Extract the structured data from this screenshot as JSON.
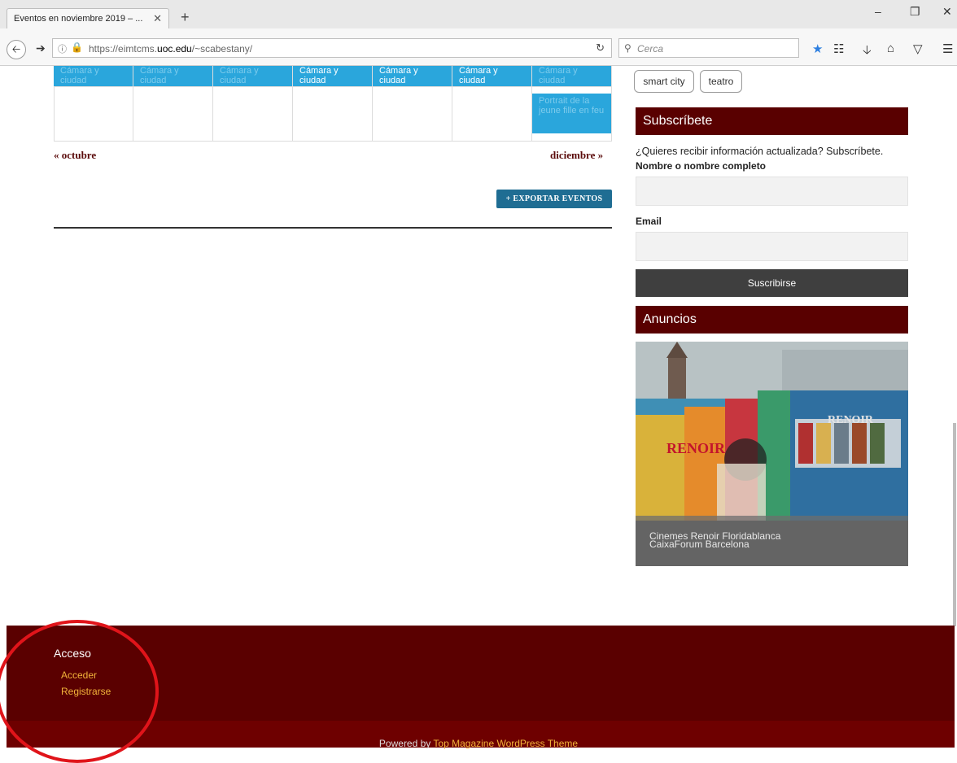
{
  "browser": {
    "tab_title": "Eventos en noviembre 2019 – ...",
    "tab_close": "✕",
    "new_tab": "+",
    "url_prefix": "https://eimtcms.",
    "url_domain": "uoc.edu",
    "url_suffix": "/~scabestany/",
    "search_placeholder": "Cerca",
    "window_controls": [
      "–",
      "❐",
      "✕"
    ]
  },
  "calendar": {
    "event_title": "Cámara y ciudad",
    "row1": [
      {
        "label": "Cámara y ciudad",
        "faded": true
      },
      {
        "label": "Cámara y ciudad",
        "faded": true
      },
      {
        "label": "Cámara y ciudad",
        "faded": true
      },
      {
        "label": "Cámara y ciudad",
        "faded": false
      },
      {
        "label": "Cámara y ciudad",
        "faded": false
      },
      {
        "label": "Cámara y ciudad",
        "faded": false
      },
      {
        "label": "Cámara y ciudad",
        "faded": true
      }
    ],
    "row2_last": "Portrait de la jeune fille en feu",
    "prev": "« octubre",
    "next": "diciembre »",
    "export": "+ EXPORTAR EVENTOS"
  },
  "sidebar": {
    "tags": [
      "smart city",
      "teatro"
    ],
    "subscribe": {
      "heading": "Subscríbete",
      "intro": "¿Quieres recibir información actualizada? Subscríbete.",
      "name_label": "Nombre o nombre completo",
      "email_label": "Email",
      "button": "Suscribirse"
    },
    "ads": {
      "heading": "Anuncios",
      "caption1": "Cinemes Renoir Floridablanca",
      "caption2": "CaixaForum Barcelona",
      "sign_text": "RENOIR"
    }
  },
  "footer": {
    "title": "Acceso",
    "links": [
      "Acceder",
      "Registrarse"
    ],
    "powered_prefix": "Powered by ",
    "powered_link": "Top Magazine WordPress Theme"
  },
  "colors": {
    "maroon": "#590000",
    "event_blue": "#2aa6dc",
    "link_gold": "#f2b33a",
    "export_blue": "#1f6d93",
    "annotation_red": "#e0141a"
  }
}
